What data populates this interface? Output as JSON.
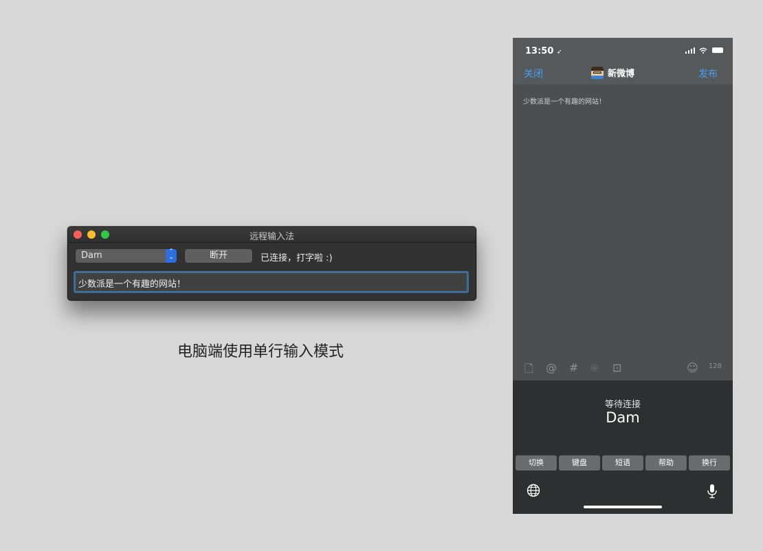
{
  "mac_window": {
    "title": "远程输入法",
    "device_select_value": "Dam",
    "disconnect_label": "断开",
    "status": "已连接，打字啦 :)",
    "input_value": "少数派是一个有趣的网站！"
  },
  "caption": "电脑端使用单行输入模式",
  "phone": {
    "status_time": "13:50",
    "status_location_glyph": "➶",
    "nav": {
      "close_label": "关闭",
      "title": "新微博",
      "publish_label": "发布"
    },
    "post_text": "少数派是一个有趣的网站！",
    "toolbar_icons": {
      "document": "🗋",
      "at": "@",
      "hashtag": "#",
      "location": "⌾",
      "camera": "⊡",
      "emoji": "☺"
    },
    "char_count": "128",
    "keyboard": {
      "status": "等待连接",
      "device_name": "Dam",
      "keys": [
        "切换",
        "键盘",
        "短语",
        "帮助",
        "换行"
      ]
    }
  },
  "colors": {
    "background": "#d8d8d8",
    "link_blue": "#4a9ff0",
    "select_accent": "#2d6fe0",
    "focus_ring": "#3e6f9b"
  },
  "icons": [
    "globe-icon",
    "microphone-icon",
    "document-icon",
    "at-icon",
    "hashtag-icon",
    "location-icon",
    "camera-icon",
    "emoji-icon",
    "wifi-icon",
    "signal-icon",
    "battery-icon",
    "avatar"
  ]
}
